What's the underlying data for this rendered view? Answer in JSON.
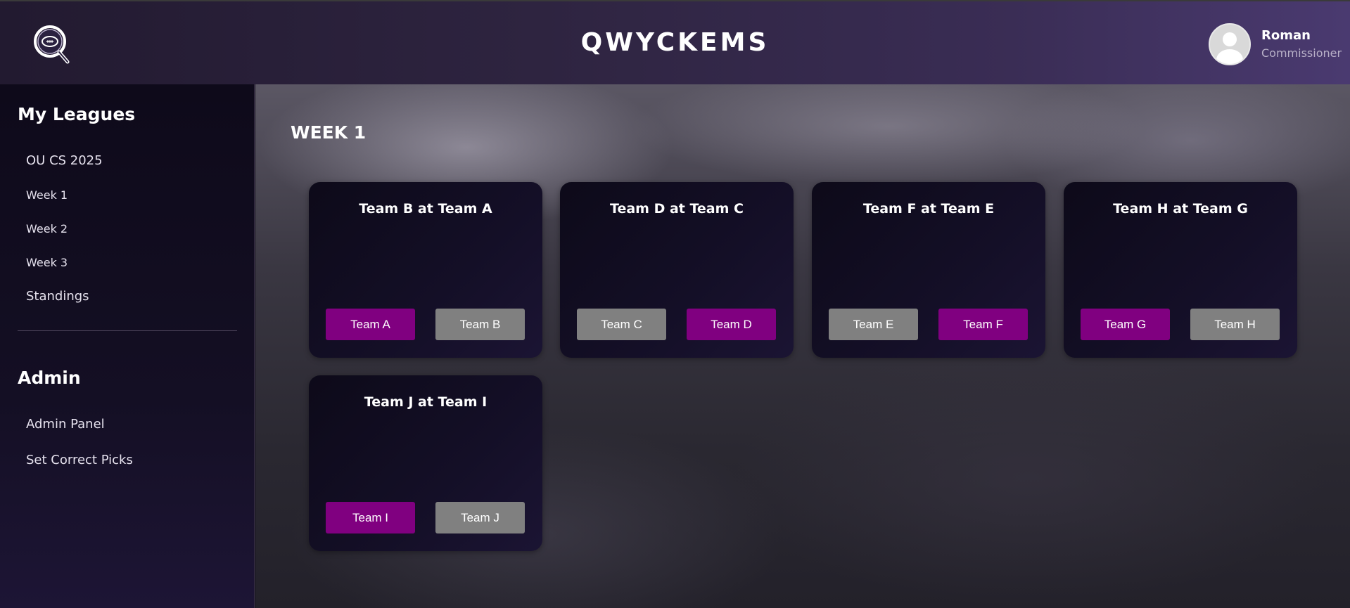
{
  "header": {
    "title": "QWYCKEMS",
    "logo_icon": "football-magnifier-logo",
    "user": {
      "name": "Roman",
      "role": "Commissioner",
      "avatar_icon": "user-avatar-icon"
    }
  },
  "sidebar": {
    "leagues_title": "My Leagues",
    "leagues": [
      {
        "label": "OU CS 2025"
      },
      {
        "label": "Week 1"
      },
      {
        "label": "Week 2"
      },
      {
        "label": "Week 3"
      },
      {
        "label": "Standings"
      }
    ],
    "admin_title": "Admin",
    "admin": [
      {
        "label": "Admin Panel"
      },
      {
        "label": "Set Correct Picks"
      }
    ]
  },
  "main": {
    "heading": "WEEK 1",
    "games": [
      {
        "title": "Team B at Team A",
        "home": "Team A",
        "away": "Team B",
        "selected": "Team A"
      },
      {
        "title": "Team D at Team C",
        "home": "Team C",
        "away": "Team D",
        "selected": "Team D"
      },
      {
        "title": "Team F at Team E",
        "home": "Team E",
        "away": "Team F",
        "selected": "Team F"
      },
      {
        "title": "Team H at Team G",
        "home": "Team G",
        "away": "Team H",
        "selected": "Team G"
      },
      {
        "title": "Team J at Team I",
        "home": "Team I",
        "away": "Team J",
        "selected": "Team I"
      }
    ]
  },
  "colors": {
    "selected": "#800080",
    "unselected": "#808080"
  }
}
